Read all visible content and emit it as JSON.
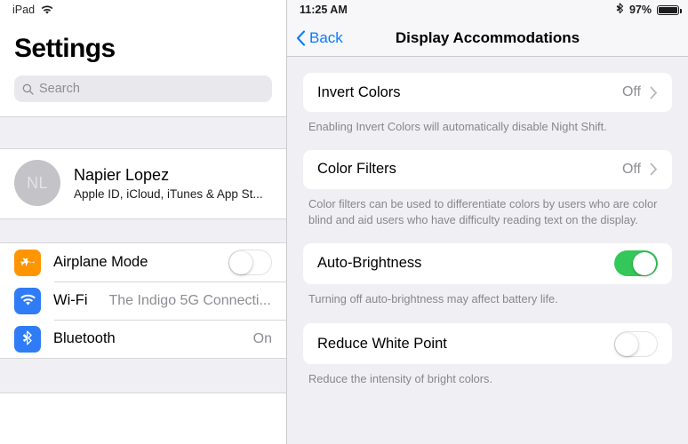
{
  "sidebar": {
    "status": {
      "device_label": "iPad",
      "wifi_icon": "wifi-icon"
    },
    "title": "Settings",
    "search": {
      "placeholder": "Search",
      "value": "",
      "icon": "search-icon"
    },
    "account": {
      "initials": "NL",
      "name": "Napier Lopez",
      "subtitle": "Apple ID, iCloud, iTunes & App St..."
    },
    "rows": [
      {
        "label": "Airplane Mode",
        "icon": "airplane-icon",
        "icon_color": "#ff9500",
        "control": "toggle",
        "state": "off"
      },
      {
        "label": "Wi-Fi",
        "icon": "wifi-icon",
        "icon_color": "#2f7cf6",
        "control": "value",
        "value": "The Indigo 5G Connecti..."
      },
      {
        "label": "Bluetooth",
        "icon": "bluetooth-icon",
        "icon_color": "#2f7cf6",
        "control": "value",
        "value": "On"
      }
    ]
  },
  "detail": {
    "status": {
      "time": "11:25 AM",
      "bluetooth_icon": "bluetooth-icon",
      "battery_percent": "97%",
      "battery_icon": "battery-icon"
    },
    "navbar": {
      "back_label": "Back",
      "back_icon": "chevron-left-icon",
      "title": "Display Accommodations"
    },
    "sections": [
      {
        "label": "Invert Colors",
        "value": "Off",
        "accessory": "chevron-right-icon",
        "footnote": "Enabling Invert Colors will automatically disable Night Shift."
      },
      {
        "label": "Color Filters",
        "value": "Off",
        "accessory": "chevron-right-icon",
        "footnote": "Color filters can be used to differentiate colors by users who are color blind and aid users who have difficulty reading text on the display."
      },
      {
        "label": "Auto-Brightness",
        "accessory": "toggle",
        "state": "on",
        "footnote": "Turning off auto-brightness may affect battery life."
      },
      {
        "label": "Reduce White Point",
        "accessory": "toggle",
        "state": "off",
        "footnote": "Reduce the intensity of bright colors."
      }
    ]
  },
  "colors": {
    "accent_blue": "#0a7cff",
    "toggle_green": "#34c759",
    "airplane_orange": "#ff9500",
    "panel_gray": "#efeff4"
  }
}
